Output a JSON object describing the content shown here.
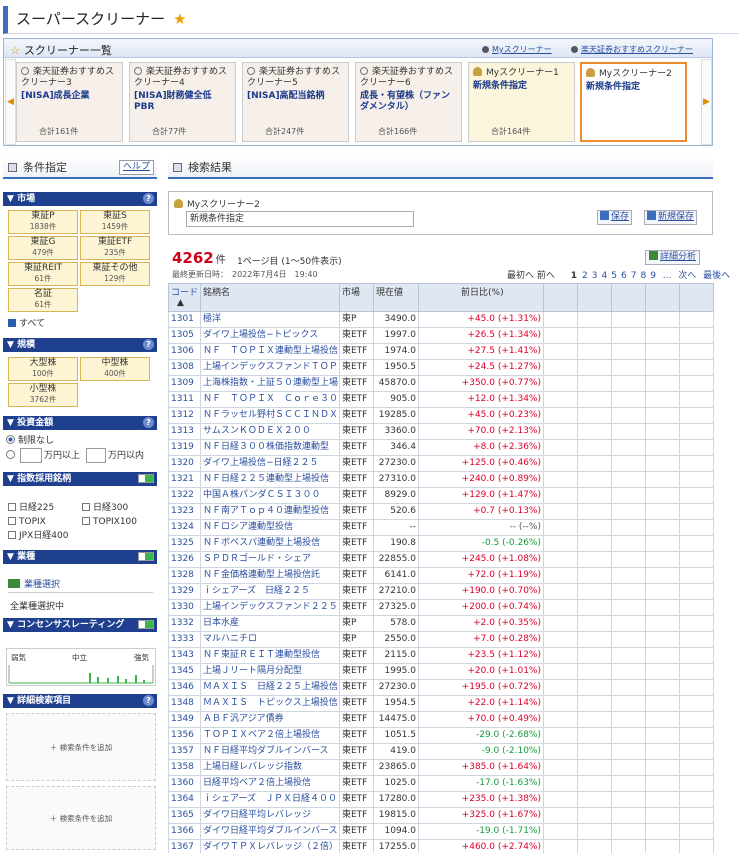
{
  "title": "スーパースクリーナー",
  "screener_list": {
    "header": "スクリーナー一覧",
    "link_my": "Myスクリーナー",
    "link_rec": "楽天証券おすすめスクリーナー",
    "cards": [
      {
        "name": "楽天証券おすすめスクリーナー3",
        "condition": "[NISA]成長企業",
        "count": "合計161件",
        "type": "rec"
      },
      {
        "name": "楽天証券おすすめスクリーナー4",
        "condition": "[NISA]財務健全低PBR",
        "count": "合計77件",
        "type": "rec"
      },
      {
        "name": "楽天証券おすすめスクリーナー5",
        "condition": "[NISA]高配当銘柄",
        "count": "合計247件",
        "type": "rec"
      },
      {
        "name": "楽天証券おすすめスクリーナー6",
        "condition": "成長・有望株（ファンダメンタル）",
        "count": "合計166件",
        "type": "rec"
      },
      {
        "name": "Myスクリーナー1",
        "condition": "新規条件指定",
        "count": "合計164件",
        "type": "my"
      },
      {
        "name": "Myスクリーナー2",
        "condition": "新規条件指定",
        "count": "",
        "type": "sel"
      }
    ]
  },
  "left": {
    "header": "条件指定",
    "help": "ヘルプ",
    "market": {
      "title": "市場",
      "items": [
        {
          "name": "東証P",
          "count": "1838件"
        },
        {
          "name": "東証S",
          "count": "1459件"
        },
        {
          "name": "東証G",
          "count": "479件"
        },
        {
          "name": "東証ETF",
          "count": "235件"
        },
        {
          "name": "東証REIT",
          "count": "61件"
        },
        {
          "name": "東証その他",
          "count": "129件"
        },
        {
          "name": "名証",
          "count": "61件"
        }
      ],
      "all": "すべて"
    },
    "scale": {
      "title": "規模",
      "items": [
        {
          "name": "大型株",
          "count": "100件"
        },
        {
          "name": "中型株",
          "count": "400件"
        },
        {
          "name": "小型株",
          "count": "3762件"
        }
      ]
    },
    "investment": {
      "title": "投資金額",
      "none": "制限なし",
      "unit_min": "万円以上",
      "unit_max": "万円以内"
    },
    "index": {
      "title": "指数採用銘柄",
      "items": [
        "日経225",
        "日経300",
        "TOPIX",
        "TOPIX100",
        "JPX日経400"
      ]
    },
    "industry": {
      "title": "業種",
      "select": "業種選択",
      "status": "全業種選択中"
    },
    "consensus": {
      "title": "コンセンサスレーティング",
      "weak": "弱気",
      "mid": "中立",
      "strong": "強気"
    },
    "detail": {
      "title": "詳細検索項目",
      "add1": "＋ 検索条件を追加",
      "add2": "＋ 検索条件を追加"
    }
  },
  "results": {
    "header": "検索結果",
    "my_name": "Myスクリーナー2",
    "cond_name": "新規条件指定",
    "save": "保存",
    "save_new": "新規保存",
    "count": "4262",
    "count_unit": "件",
    "page_info": "1ページ目 (1〜50件表示)",
    "updated": "最終更新日時：　2022年7月4日　19:40",
    "detail_analysis": "詳細分析",
    "pager": {
      "first": "最初へ",
      "prev": "前へ",
      "current": "1",
      "pages": [
        "2",
        "3",
        "4",
        "5",
        "6",
        "7",
        "8",
        "9"
      ],
      "ellipsis": "...",
      "next": "次へ",
      "last": "最後へ"
    },
    "columns": {
      "code": "コード",
      "sort": "▲",
      "name": "銘柄名",
      "market": "市場",
      "price": "現在値",
      "change": "前日比(%)"
    },
    "rows": [
      {
        "code": "1301",
        "name": "極洋",
        "market": "東P",
        "price": "3490.0",
        "change": "+45.0 (+1.31%)",
        "dir": "up"
      },
      {
        "code": "1305",
        "name": "ダイワ上場投信−トピックス",
        "market": "東ETF",
        "price": "1997.0",
        "change": "+26.5 (+1.34%)",
        "dir": "up"
      },
      {
        "code": "1306",
        "name": "ＮＦ　ＴＯＰＩＸ連動型上場投信",
        "market": "東ETF",
        "price": "1974.0",
        "change": "+27.5 (+1.41%)",
        "dir": "up"
      },
      {
        "code": "1308",
        "name": "上場インデックスファンドＴＯＰＩＸ",
        "market": "東ETF",
        "price": "1950.5",
        "change": "+24.5 (+1.27%)",
        "dir": "up"
      },
      {
        "code": "1309",
        "name": "上海株指数・上証５０連動型上場",
        "market": "東ETF",
        "price": "45870.0",
        "change": "+350.0 (+0.77%)",
        "dir": "up"
      },
      {
        "code": "1311",
        "name": "ＮＦ　ＴＯＰＩＸ　Ｃｏｒｅ３０",
        "market": "東ETF",
        "price": "905.0",
        "change": "+12.0 (+1.34%)",
        "dir": "up"
      },
      {
        "code": "1312",
        "name": "ＮＦラッセル野村ＳＣＣＩＮＤＸ",
        "market": "東ETF",
        "price": "19285.0",
        "change": "+45.0 (+0.23%)",
        "dir": "up"
      },
      {
        "code": "1313",
        "name": "サムスンＫＯＤＥＸ２００",
        "market": "東ETF",
        "price": "3360.0",
        "change": "+70.0 (+2.13%)",
        "dir": "up"
      },
      {
        "code": "1319",
        "name": "ＮＦ日経３００株価指数連動型",
        "market": "東ETF",
        "price": "346.4",
        "change": "+8.0 (+2.36%)",
        "dir": "up"
      },
      {
        "code": "1320",
        "name": "ダイワ上場投信−日経２２５",
        "market": "東ETF",
        "price": "27230.0",
        "change": "+125.0 (+0.46%)",
        "dir": "up"
      },
      {
        "code": "1321",
        "name": "ＮＦ日経２２５連動型上場投信",
        "market": "東ETF",
        "price": "27310.0",
        "change": "+240.0 (+0.89%)",
        "dir": "up"
      },
      {
        "code": "1322",
        "name": "中国Ａ株パンダＣＳＩ３００",
        "market": "東ETF",
        "price": "8929.0",
        "change": "+129.0 (+1.47%)",
        "dir": "up"
      },
      {
        "code": "1323",
        "name": "ＮＦ南アＴｏｐ４０連動型投信",
        "market": "東ETF",
        "price": "520.6",
        "change": "+0.7 (+0.13%)",
        "dir": "up"
      },
      {
        "code": "1324",
        "name": "ＮＦロシア連動型投信",
        "market": "東ETF",
        "price": "--",
        "change": "-- (--%)",
        "dir": "fl"
      },
      {
        "code": "1325",
        "name": "ＮＦボベスパ連動型上場投信",
        "market": "東ETF",
        "price": "190.8",
        "change": "-0.5 (-0.26%)",
        "dir": "dn"
      },
      {
        "code": "1326",
        "name": "ＳＰＤＲゴールド・シェア",
        "market": "東ETF",
        "price": "22855.0",
        "change": "+245.0 (+1.08%)",
        "dir": "up"
      },
      {
        "code": "1328",
        "name": "ＮＦ金価格連動型上場投信託",
        "market": "東ETF",
        "price": "6141.0",
        "change": "+72.0 (+1.19%)",
        "dir": "up"
      },
      {
        "code": "1329",
        "name": "ｉシェアーズ　日経２２５",
        "market": "東ETF",
        "price": "27210.0",
        "change": "+190.0 (+0.70%)",
        "dir": "up"
      },
      {
        "code": "1330",
        "name": "上場インデックスファンド２２５",
        "market": "東ETF",
        "price": "27325.0",
        "change": "+200.0 (+0.74%)",
        "dir": "up"
      },
      {
        "code": "1332",
        "name": "日本水産",
        "market": "東P",
        "price": "578.0",
        "change": "+2.0 (+0.35%)",
        "dir": "up"
      },
      {
        "code": "1333",
        "name": "マルハニチロ",
        "market": "東P",
        "price": "2550.0",
        "change": "+7.0 (+0.28%)",
        "dir": "up"
      },
      {
        "code": "1343",
        "name": "ＮＦ東証ＲＥＩＴ連動型投信",
        "market": "東ETF",
        "price": "2115.0",
        "change": "+23.5 (+1.12%)",
        "dir": "up"
      },
      {
        "code": "1345",
        "name": "上場Ｊリート隔月分配型",
        "market": "東ETF",
        "price": "1995.0",
        "change": "+20.0 (+1.01%)",
        "dir": "up"
      },
      {
        "code": "1346",
        "name": "ＭＡＸＩＳ　日経２２５上場投信",
        "market": "東ETF",
        "price": "27230.0",
        "change": "+195.0 (+0.72%)",
        "dir": "up"
      },
      {
        "code": "1348",
        "name": "ＭＡＸＩＳ　トピックス上場投信",
        "market": "東ETF",
        "price": "1954.5",
        "change": "+22.0 (+1.14%)",
        "dir": "up"
      },
      {
        "code": "1349",
        "name": "ＡＢＦ汎アジア債券",
        "market": "東ETF",
        "price": "14475.0",
        "change": "+70.0 (+0.49%)",
        "dir": "up"
      },
      {
        "code": "1356",
        "name": "ＴＯＰＩＸベア２倍上場投信",
        "market": "東ETF",
        "price": "1051.5",
        "change": "-29.0 (-2.68%)",
        "dir": "dn"
      },
      {
        "code": "1357",
        "name": "ＮＦ日経平均ダブルインバース",
        "market": "東ETF",
        "price": "419.0",
        "change": "-9.0 (-2.10%)",
        "dir": "dn"
      },
      {
        "code": "1358",
        "name": "上場日経レバレッジ指数",
        "market": "東ETF",
        "price": "23865.0",
        "change": "+385.0 (+1.64%)",
        "dir": "up"
      },
      {
        "code": "1360",
        "name": "日経平均ベア２倍上場投信",
        "market": "東ETF",
        "price": "1025.0",
        "change": "-17.0 (-1.63%)",
        "dir": "dn"
      },
      {
        "code": "1364",
        "name": "ｉシェアーズ　ＪＰＸ日経４００",
        "market": "東ETF",
        "price": "17280.0",
        "change": "+235.0 (+1.38%)",
        "dir": "up"
      },
      {
        "code": "1365",
        "name": "ダイワ日経平均レバレッジ",
        "market": "東ETF",
        "price": "19815.0",
        "change": "+325.0 (+1.67%)",
        "dir": "up"
      },
      {
        "code": "1366",
        "name": "ダイワ日経平均ダブルインバース",
        "market": "東ETF",
        "price": "1094.0",
        "change": "-19.0 (-1.71%)",
        "dir": "dn"
      },
      {
        "code": "1367",
        "name": "ダイワＴＰＸレバレッジ（２倍）",
        "market": "東ETF",
        "price": "17255.0",
        "change": "+460.0 (+2.74%)",
        "dir": "up"
      }
    ]
  },
  "colors": {
    "accent": "#1f3f8f",
    "up": "#e0002a",
    "down": "#169a3a",
    "selected": "#e98b2e"
  }
}
